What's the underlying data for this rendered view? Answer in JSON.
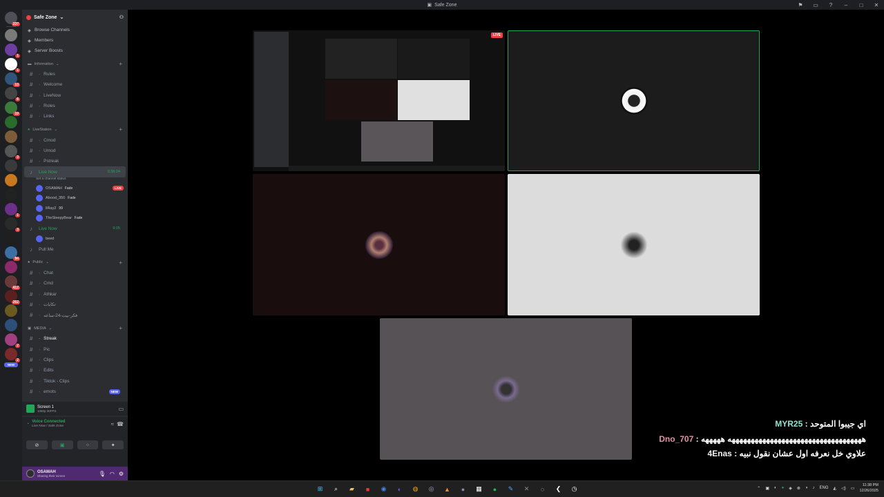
{
  "window": {
    "title": "Safe Zone",
    "controls": [
      "inbox-icon",
      "window-icon",
      "help-icon",
      "minimize-icon",
      "maximize-icon",
      "close-icon"
    ]
  },
  "rail": {
    "servers": [
      {
        "color": "#4e5058",
        "badge": "237"
      },
      {
        "color": "#7a7a7a",
        "badge": ""
      },
      {
        "color": "#6b3fa0",
        "badge": "1"
      },
      {
        "color": "#ffffff",
        "badge": "1"
      },
      {
        "color": "#30557a",
        "badge": "13"
      },
      {
        "color": "#444444",
        "badge": "6"
      },
      {
        "color": "#3b7a3b",
        "badge": "19"
      },
      {
        "color": "#2a6a2a",
        "badge": ""
      },
      {
        "color": "#7d5c3a",
        "badge": ""
      },
      {
        "color": "#555555",
        "badge": "3"
      },
      {
        "color": "#3a3a3a",
        "badge": ""
      },
      {
        "color": "#c8781e",
        "badge": ""
      },
      {
        "color": "#222222",
        "badge": ""
      },
      {
        "color": "#6c2f8a",
        "badge": "1"
      },
      {
        "color": "#2a2a2a",
        "badge": "3"
      },
      {
        "color": "#1f1f1f",
        "badge": ""
      },
      {
        "color": "#3c6fa3",
        "badge": "94"
      },
      {
        "color": "#8a2b6a",
        "badge": ""
      },
      {
        "color": "#6a3a3a",
        "badge": "412"
      },
      {
        "color": "#5a1f1f",
        "badge": "262"
      },
      {
        "color": "#6b5a20",
        "badge": ""
      },
      {
        "color": "#2e4f7a",
        "badge": ""
      },
      {
        "color": "#a04080",
        "badge": "2"
      },
      {
        "color": "#7a2a2a",
        "badge": "2"
      }
    ],
    "new_label": "NEW"
  },
  "server": {
    "name": "Safe Zone"
  },
  "menu": [
    {
      "icon": "browse-icon",
      "label": "Browse Channels"
    },
    {
      "icon": "members-icon",
      "label": "Members"
    },
    {
      "icon": "boost-icon",
      "label": "Server Boosts"
    }
  ],
  "categories": {
    "information": "Information",
    "livestation": "LiveStation",
    "public": "Public",
    "media": "MEDIA"
  },
  "info_channels": [
    "Rules",
    "Welcome",
    "LiveNow",
    "Roles",
    "Links"
  ],
  "livestation_channels": [
    "Cmod",
    "Umod",
    "Pstreak"
  ],
  "live_now_1": {
    "label": "Live Now",
    "time": "3:38:24",
    "status": "Set a channel status"
  },
  "voice_users_1": [
    {
      "name": "OSAMAH",
      "tag": "Fade",
      "live": true
    },
    {
      "name": "Abood_350",
      "tag": "Fade",
      "live": false
    },
    {
      "name": "liRay2",
      "tag": "99",
      "live": false
    },
    {
      "name": "TheSleepyBear",
      "tag": "Fade",
      "live": false
    }
  ],
  "live_now_2": {
    "label": "Live Now",
    "time": "9:05"
  },
  "voice_users_2": [
    {
      "name": "beed"
    }
  ],
  "pull_me": "Pull Me",
  "public_channels": [
    "Chat",
    "Cmd",
    "Athkar",
    "تكايات",
    "فكر-بيت-24-ساعه"
  ],
  "media_channels": [
    "Streak",
    "Pic",
    "Clips",
    "Edits",
    "Tiktok - Clips",
    "emots"
  ],
  "live_pill": "LIVE",
  "new_pill": "NEW",
  "screen": {
    "title": "Screen 1",
    "sub": "1080p 30FPS"
  },
  "voice": {
    "status": "Voice Connected",
    "channel": "Live Now / Safe Zone"
  },
  "user": {
    "name": "OSAMAH",
    "status": "Sharing their screen"
  },
  "chat_overlay": [
    {
      "user": "MYR25",
      "sep": " : ",
      "text": "اي جيبوا المتوحد"
    },
    {
      "user": "Dno_707",
      "sep": " : ",
      "text": "هههههههههههههههههههههههههههههههههههه هههههه"
    },
    {
      "user": "4Enas",
      "sep": " : ",
      "text": "علاوي خل نعرفه اول عشان نقول نبيه"
    }
  ],
  "clock": {
    "time": "11:38 PM",
    "date": "12/26/2025",
    "lang": "ENG"
  },
  "colors": {
    "accent_green": "#23a559",
    "live_red": "#f23f43",
    "user_panel": "#4f2a71"
  }
}
